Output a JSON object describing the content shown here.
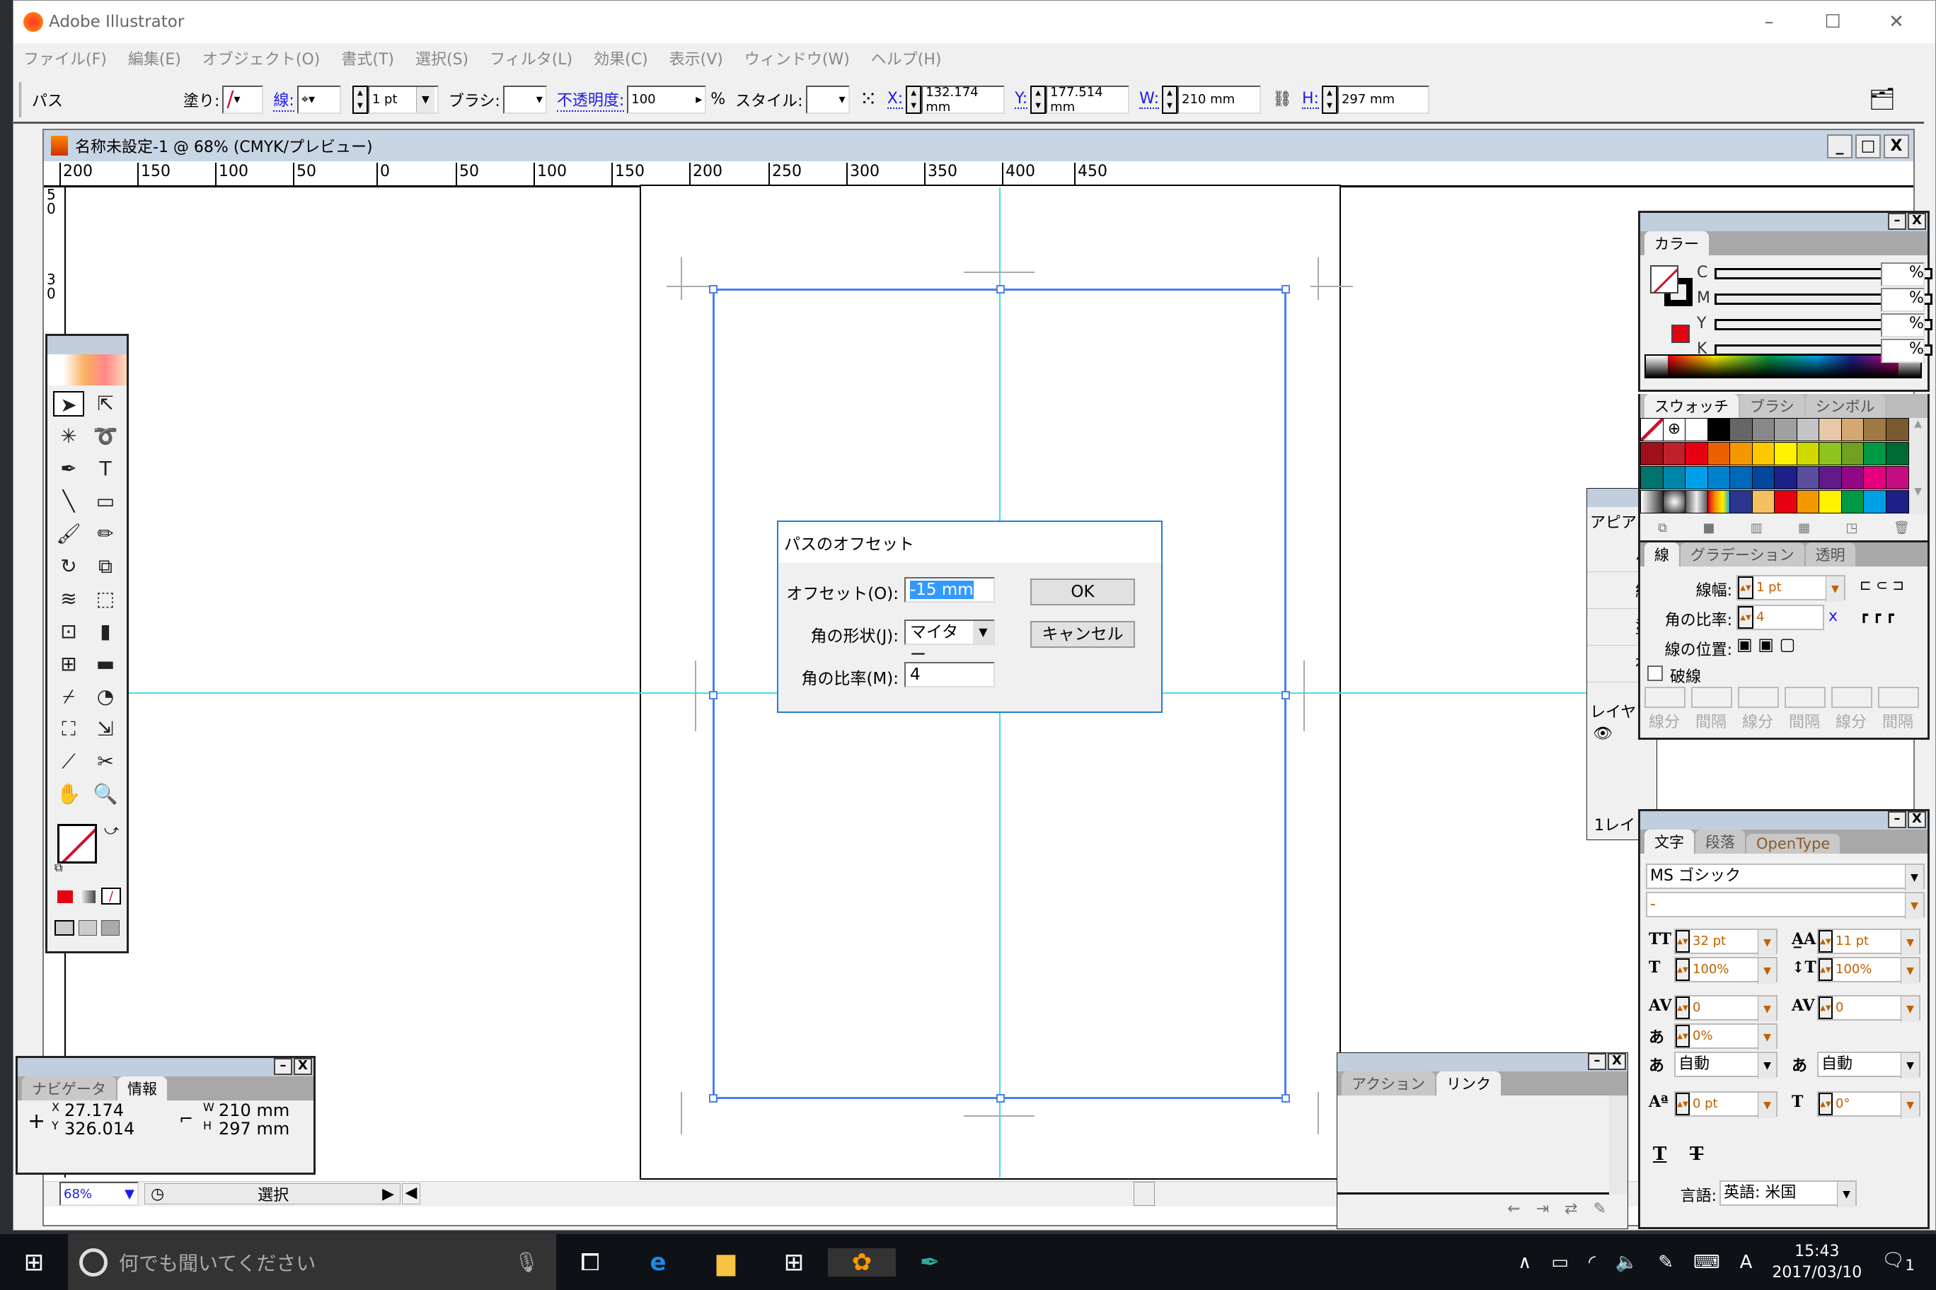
{
  "app": {
    "title": "Adobe Illustrator",
    "window_controls": {
      "minimize": "–",
      "maximize": "☐",
      "close": "✕"
    }
  },
  "menu": [
    "ファイル(F)",
    "編集(E)",
    "オブジェクト(O)",
    "書式(T)",
    "選択(S)",
    "フィルタ(L)",
    "効果(C)",
    "表示(V)",
    "ウィンドウ(W)",
    "ヘルプ(H)"
  ],
  "control_bar": {
    "object_type": "パス",
    "fill_label": "塗り:",
    "stroke_label": "線:",
    "stroke_weight": "1 pt",
    "brush_label": "ブラシ:",
    "opacity_label": "不透明度:",
    "opacity": "100",
    "percent": "%",
    "style_label": "スタイル:",
    "x_label": "X:",
    "x": "132.174 mm",
    "y_label": "Y:",
    "y": "177.514 mm",
    "w_label": "W:",
    "w": "210 mm",
    "h_label": "H:",
    "h": "297 mm"
  },
  "document": {
    "title": "名称未設定-1 @ 68% (CMYK/プレビュー)",
    "ruler_top": [
      "200",
      "150",
      "100",
      "50",
      "0",
      "50",
      "100",
      "150",
      "200",
      "250",
      "300",
      "350",
      "400",
      "450"
    ],
    "ruler_left": [
      "5\n0",
      "3\n0",
      "5\n0"
    ],
    "zoom": "68%",
    "status": "選択"
  },
  "colors": {
    "accent": "#1d7fd8",
    "selection": "#4a7ef0",
    "guide": "#3fe0e8",
    "none_red": "#d0102a"
  },
  "dialog": {
    "title": "パスのオフセット",
    "offset_label": "オフセット(O):",
    "offset_value": "-15 mm",
    "joins_label": "角の形状(J):",
    "joins_value": "マイター",
    "miter_label": "角の比率(M):",
    "miter_value": "4",
    "ok": "OK",
    "cancel": "キャンセル"
  },
  "toolbox": {
    "tools": [
      "selection",
      "direct-selection",
      "magic-wand",
      "lasso",
      "pen",
      "type",
      "line-segment",
      "rectangle",
      "paintbrush",
      "pencil",
      "rotate",
      "scale",
      "warp",
      "free-transform",
      "symbol-sprayer",
      "column-graph",
      "mesh",
      "gradient",
      "eyedropper",
      "blend",
      "live-paint-bucket",
      "live-paint-selection",
      "slice",
      "scissors",
      "hand",
      "zoom"
    ]
  },
  "color_panel": {
    "tab": "カラー",
    "channels": [
      "C",
      "M",
      "Y",
      "K"
    ],
    "percent": "%"
  },
  "swatches_panel": {
    "tabs": [
      "スウォッチ",
      "ブラシ",
      "シンボル"
    ],
    "rows": [
      [
        "none",
        "registration",
        "#ffffff",
        "#000000",
        "#666666",
        "#888888",
        "#a0a0a0",
        "#c4c4c4",
        "#e7c9a9",
        "#d4a873",
        "#9e7a45",
        "#7a5a33"
      ],
      [
        "#a0101a",
        "#c0202a",
        "#e60012",
        "#eb6100",
        "#f39800",
        "#fcc800",
        "#fff100",
        "#cfdb00",
        "#8fc31f",
        "#6fa01f",
        "#009944",
        "#006934"
      ],
      [
        "#00736d",
        "#0086ab",
        "#00a0e9",
        "#0081cc",
        "#0068b7",
        "#00479d",
        "#1d2088",
        "#5a4d9e",
        "#601986",
        "#920783",
        "#e4007f",
        "#c30d81"
      ],
      [
        "linear-gradient(90deg,#fff,#333)",
        "radial-gradient(circle,#fff,#222)",
        "linear-gradient(90deg,#555,#eee,#555)",
        "linear-gradient(90deg,#e60012,#f39800,#fff100,#00a0e9)",
        "#2a3590",
        "#f5c060",
        "#e60012",
        "#f39800",
        "#fff100",
        "#009944",
        "#00a0e9",
        "#1d2088"
      ]
    ]
  },
  "appearance_panel": {
    "tab": "アピア",
    "rows": [
      "パ",
      "線",
      "塗",
      "初"
    ],
    "layers_tab": "レイヤ",
    "layers_count": "1レイ"
  },
  "stroke_panel": {
    "tabs": [
      "線",
      "グラデーション",
      "透明"
    ],
    "weight_label": "線幅:",
    "weight": "1 pt",
    "miter_label": "角の比率:",
    "miter": "4",
    "miter_unit": "x",
    "align_label": "線の位置:",
    "dashed_label": "破線",
    "dash_labels": [
      "線分",
      "間隔",
      "線分",
      "間隔",
      "線分",
      "間隔"
    ]
  },
  "character_panel": {
    "tabs": [
      "文字",
      "段落",
      "OpenType"
    ],
    "font": "MS ゴシック",
    "style": "-",
    "size": "32 pt",
    "leading": "11 pt",
    "hscale": "100%",
    "vscale": "100%",
    "kerning": "0",
    "tracking": "0",
    "tsume": "0%",
    "aki_left": "自動",
    "aki_right": "自動",
    "baseline": "0 pt",
    "rotation": "0°",
    "language_label": "言語:",
    "language": "英語: 米国"
  },
  "info_panel": {
    "tabs": [
      "ナビゲータ",
      "情報"
    ],
    "x_label": "X",
    "x": "27.174",
    "y_label": "Y",
    "y": "326.014",
    "w_label": "W",
    "w": "210 mm",
    "h_label": "H",
    "h": "297 mm"
  },
  "actions_panel": {
    "tabs": [
      "アクション",
      "リンク"
    ]
  },
  "taskbar": {
    "search_placeholder": "何でも聞いてください",
    "time": "15:43",
    "date": "2017/03/10",
    "ime": "A",
    "notifications": "1"
  }
}
